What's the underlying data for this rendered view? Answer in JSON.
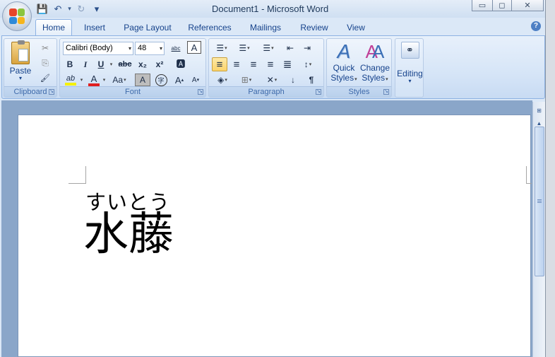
{
  "window": {
    "title": "Document1 - Microsoft Word",
    "minimize_label": "▭",
    "maximize_label": "◻",
    "close_label": "✕"
  },
  "qat": {
    "save_icon": "💾",
    "undo_icon": "↶",
    "redo_icon": "↻",
    "customize_icon": "▾"
  },
  "tabs": [
    {
      "label": "Home",
      "active": true
    },
    {
      "label": "Insert"
    },
    {
      "label": "Page Layout"
    },
    {
      "label": "References"
    },
    {
      "label": "Mailings"
    },
    {
      "label": "Review"
    },
    {
      "label": "View"
    }
  ],
  "help_label": "?",
  "ribbon": {
    "clipboard": {
      "label": "Clipboard",
      "paste_label": "Paste",
      "paste_arrow": "▾",
      "cut_icon": "✂",
      "copy_icon": "⎘",
      "format_painter_icon": "🖌"
    },
    "font": {
      "label": "Font",
      "font_name": "Calibri (Body)",
      "font_size": "48",
      "phonetic_guide_label": "abc",
      "char_border_label": "A",
      "bold": "B",
      "italic": "I",
      "underline": "U",
      "strikethrough": "abc",
      "subscript": "x₂",
      "superscript": "x²",
      "clear_format_label": "🅰",
      "highlight_label": "ab",
      "font_color_label": "A",
      "change_case_label": "Aa",
      "char_shading_label": "A",
      "enclose_label": "字",
      "grow_label": "A",
      "shrink_label": "A",
      "highlight_color": "#f5f000",
      "font_color": "#e02020"
    },
    "paragraph": {
      "label": "Paragraph",
      "bullets_icon": "☰",
      "numbering_icon": "☰",
      "multilevel_icon": "☰",
      "decrease_indent_icon": "⇤",
      "increase_indent_icon": "⇥",
      "align_left_icon": "≡",
      "center_icon": "≡",
      "align_right_icon": "≡",
      "justify_icon": "≡",
      "distributed_icon": "≣",
      "line_spacing_icon": "↕",
      "shading_icon": "◈",
      "borders_icon": "⊞",
      "asian_layout_icon": "✕",
      "sort_icon": "↓",
      "show_marks_icon": "¶"
    },
    "styles": {
      "label": "Styles",
      "quick_styles_line1": "Quick",
      "quick_styles_line2": "Styles",
      "change_styles_line1": "Change",
      "change_styles_line2": "Styles",
      "arrow": "▾"
    },
    "editing": {
      "label": "Editing",
      "arrow": "▾"
    }
  },
  "document": {
    "ruby_text": "すいとう",
    "base_text": "水藤"
  },
  "scrollbar": {
    "up_label": "▲",
    "ruler_toggle_icon": "⊞"
  }
}
